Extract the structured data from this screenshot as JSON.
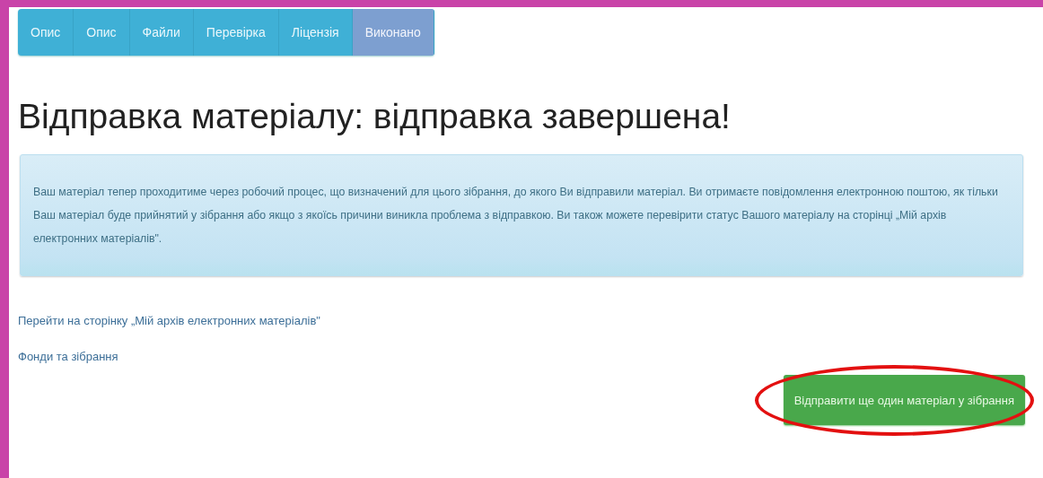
{
  "tabs": [
    {
      "label": "Опис",
      "selected": false
    },
    {
      "label": "Опис",
      "selected": false
    },
    {
      "label": "Файли",
      "selected": false
    },
    {
      "label": "Перевірка",
      "selected": false
    },
    {
      "label": "Ліцензія",
      "selected": false
    },
    {
      "label": "Виконано",
      "selected": true
    }
  ],
  "title": "Відправка матеріалу: відправка завершена!",
  "alert": "Ваш матеріал тепер проходитиме через робочий процес, що визначений для цього зібрання, до якого Ви відправили матеріал. Ви отримаєте повідомлення електронною поштою, як тільки Ваш матеріал буде прийнятий у зібрання або якщо з якоїсь причини виникла проблема з відправкою. Ви також можете перевірити статус Вашого матеріалу на сторінці „Мій архів електронних матеріалів\".",
  "links": [
    "Перейти на сторінку „Мій архів електронних матеріалів\"",
    "Фонди та зібрання"
  ],
  "button": {
    "label": "Відправити ще один матеріал у зібрання",
    "highlighted": true
  }
}
